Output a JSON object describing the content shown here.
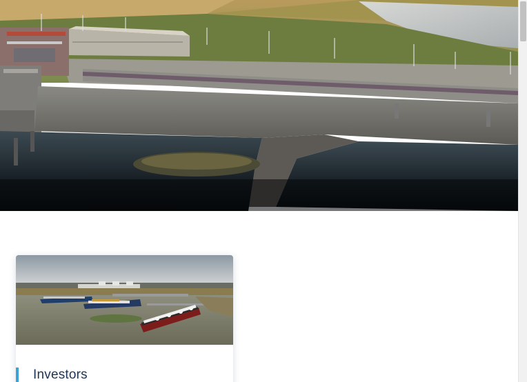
{
  "hero": {
    "image": "aerial-lng-terminal-photo"
  },
  "cards": [
    {
      "image": "lng-tankers-at-terminal-photo",
      "title": "Investors",
      "accent_color": "#3aa3d6"
    }
  ],
  "colors": {
    "title_text": "#1d3553",
    "accent": "#3aa3d6",
    "page_background": "#ffffff"
  }
}
